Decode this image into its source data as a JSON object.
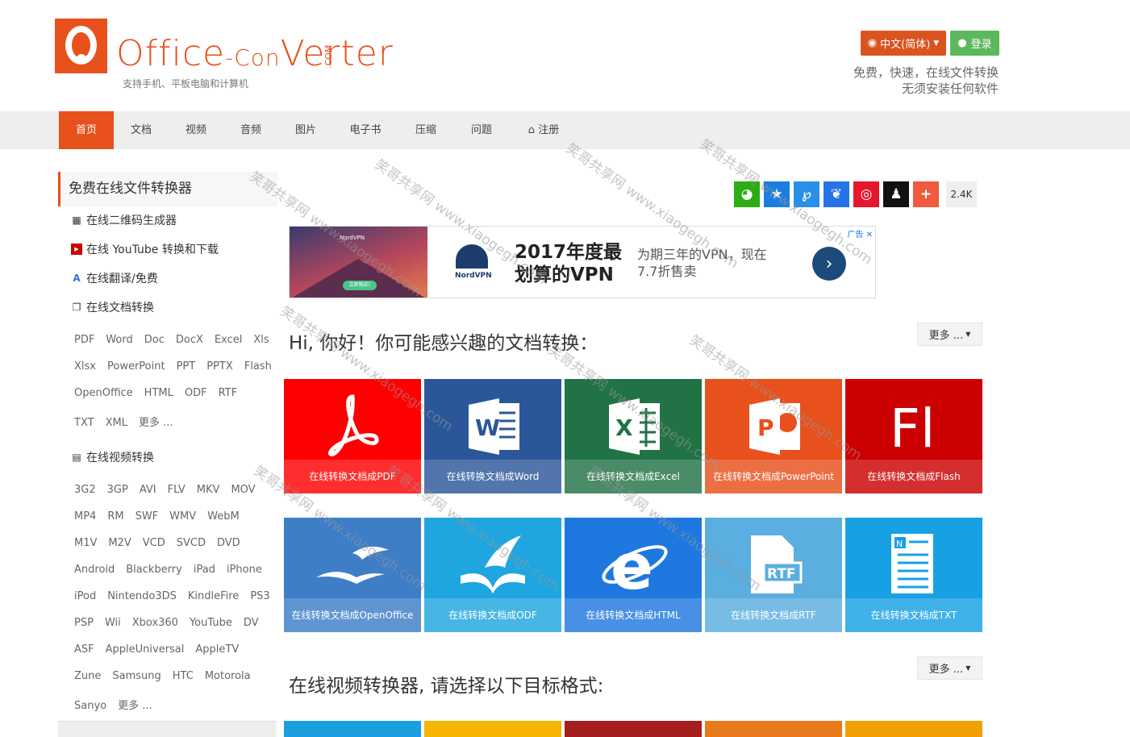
{
  "header": {
    "logo_main": "Office",
    "logo_dash": "-Con",
    "logo_rest": "Verter",
    "logo_com": ".COM",
    "logo_sub": "支持手机、平板电脑和计算机",
    "lang_label": "中文(简体)",
    "login_label": "登录",
    "tagline_1": "免费，快速，在线文件转换",
    "tagline_2": "无须安装任何软件"
  },
  "nav": {
    "items": [
      "首页",
      "文档",
      "视频",
      "音频",
      "图片",
      "电子书",
      "压缩",
      "问题",
      "注册"
    ]
  },
  "sidebar": {
    "title": "免费在线文件转换器",
    "links": [
      "在线二维码生成器",
      "在线 YouTube 转换和下载",
      "在线翻译/免费",
      "在线文档转换"
    ],
    "doc_formats": [
      [
        "PDF",
        "Word",
        "Doc",
        "DocX",
        "Excel",
        "Xls"
      ],
      [
        "Xlsx",
        "PowerPoint",
        "PPT",
        "PPTX",
        "Flash"
      ],
      [
        "OpenOffice",
        "HTML",
        "ODF",
        "RTF"
      ],
      [
        "TXT",
        "XML",
        "更多 ..."
      ]
    ],
    "video_title": "在线视频转换",
    "video_formats": [
      [
        "3G2",
        "3GP",
        "AVI",
        "FLV",
        "MKV",
        "MOV"
      ],
      [
        "MP4",
        "RM",
        "SWF",
        "WMV",
        "WebM"
      ],
      [
        "M1V",
        "M2V",
        "VCD",
        "SVCD",
        "DVD"
      ],
      [
        "Android",
        "Blackberry",
        "iPad",
        "iPhone"
      ],
      [
        "iPod",
        "Nintendo3DS",
        "KindleFire",
        "PS3"
      ],
      [
        "PSP",
        "Wii",
        "Xbox360",
        "YouTube",
        "DV"
      ],
      [
        "ASF",
        "AppleUniversal",
        "AppleTV"
      ],
      [
        "Zune",
        "Samsung",
        "HTC",
        "Motorola"
      ],
      [
        "Sanyo",
        "更多 ..."
      ]
    ]
  },
  "share": {
    "count": "2.4K",
    "colors": [
      "#2bad13",
      "#1a7ee0",
      "#2a8fe8",
      "#2573e6",
      "#e6162d",
      "#111111",
      "#f05a3e"
    ]
  },
  "ad": {
    "brand": "NordVPN",
    "title_1": "2017年度最",
    "title_2": "划算的VPN",
    "desc_1": "为期三年的VPN，现在",
    "desc_2": "7.7折售卖",
    "cta": "立即购买!",
    "badge": "广告 ✕"
  },
  "section1": {
    "title": "Hi, 你好！你可能感兴趣的文档转换：",
    "more": "更多 ..."
  },
  "tiles": [
    {
      "label": "在线转换文档成PDF",
      "color": "#ff0000"
    },
    {
      "label": "在线转换文档成Word",
      "color": "#2b579a"
    },
    {
      "label": "在线转换文档成Excel",
      "color": "#217346"
    },
    {
      "label": "在线转换文档成PowerPoint",
      "color": "#e8501c"
    },
    {
      "label": "在线转换文档成Flash",
      "color": "#cc0000"
    },
    {
      "label": "在线转换文档成OpenOffice",
      "color": "#3d7ec7"
    },
    {
      "label": "在线转换文档成ODF",
      "color": "#1fa6e0"
    },
    {
      "label": "在线转换文档成HTML",
      "color": "#1f78e0"
    },
    {
      "label": "在线转换文档成RTF",
      "color": "#5aaee0"
    },
    {
      "label": "在线转换文档成TXT",
      "color": "#17a0e4"
    }
  ],
  "section2": {
    "title": "在线视频转换器, 请选择以下目标格式:",
    "more": "更多 ..."
  },
  "bottom_tiles": [
    "#1aa0e0",
    "#f5b400",
    "#a51e1e",
    "#e87a1c",
    "#f0a000"
  ],
  "watermark": "笑哥共享网 www.xiaogegh.com"
}
